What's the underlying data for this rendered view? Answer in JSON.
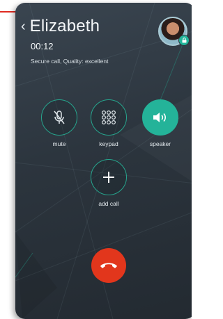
{
  "call": {
    "contact_name": "Elizabeth",
    "duration": "00:12",
    "status": "Secure call, Quality: excellent"
  },
  "controls": [
    {
      "label": "mute",
      "icon": "mic-off-icon",
      "active": false
    },
    {
      "label": "keypad",
      "icon": "keypad-icon",
      "active": false
    },
    {
      "label": "speaker",
      "icon": "speaker-icon",
      "active": true
    },
    {
      "label": "add call",
      "icon": "plus-icon",
      "active": false
    }
  ],
  "end_call_icon": "hang-up-icon",
  "colors": {
    "accent": "#24b399",
    "end_call": "#e2361c",
    "background": "#2c353e"
  }
}
